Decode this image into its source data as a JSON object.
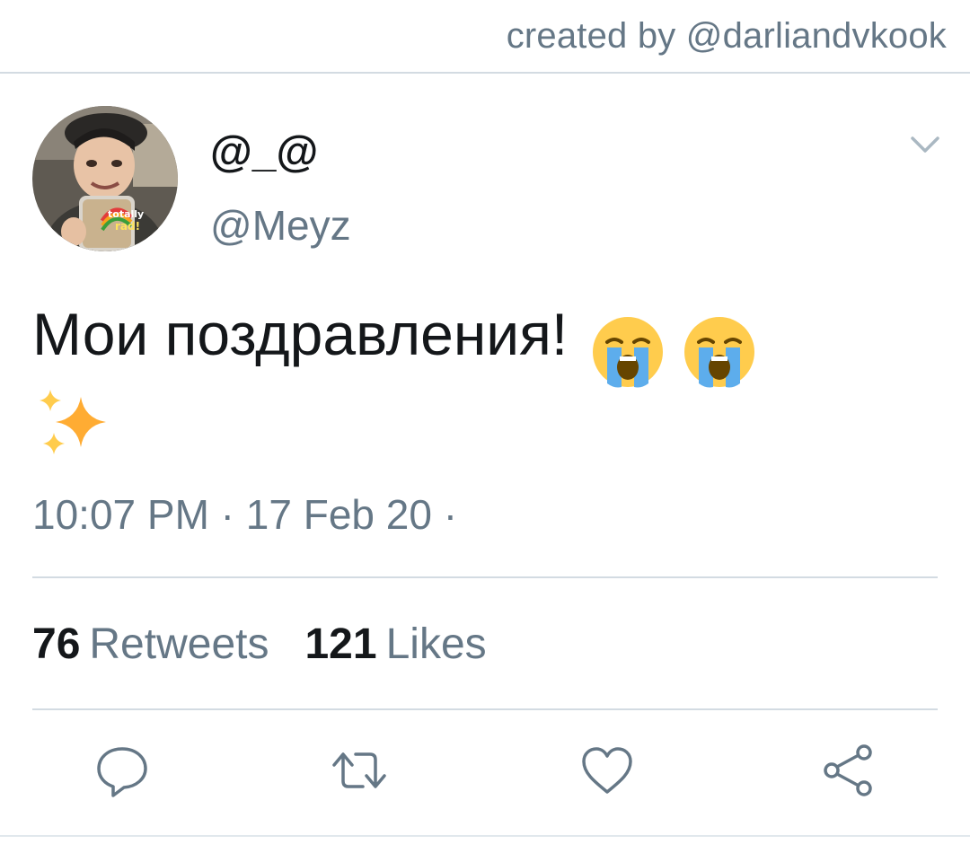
{
  "watermark": {
    "text": "created by @darliandvkook"
  },
  "tweet": {
    "display_name": "@_@",
    "handle": "@Meyz",
    "text": "Мои поздравления!",
    "emojis": [
      "loudly-crying-face-icon",
      "loudly-crying-face-icon",
      "sparkles-icon"
    ],
    "avatar_sticker_text": "totally rad!",
    "timestamp": "10:07 PM · 17 Feb 20 ·",
    "stats": {
      "retweets_count": "76",
      "retweets_label": "Retweets",
      "likes_count": "121",
      "likes_label": "Likes"
    }
  },
  "actions": [
    {
      "name": "reply",
      "icon": "reply-icon"
    },
    {
      "name": "retweet",
      "icon": "retweet-icon"
    },
    {
      "name": "like",
      "icon": "heart-icon"
    },
    {
      "name": "share",
      "icon": "share-icon"
    }
  ],
  "colors": {
    "primary_text": "#14171a",
    "secondary_text": "#657786",
    "divider": "#d3dbe2",
    "icon": "#657786"
  }
}
